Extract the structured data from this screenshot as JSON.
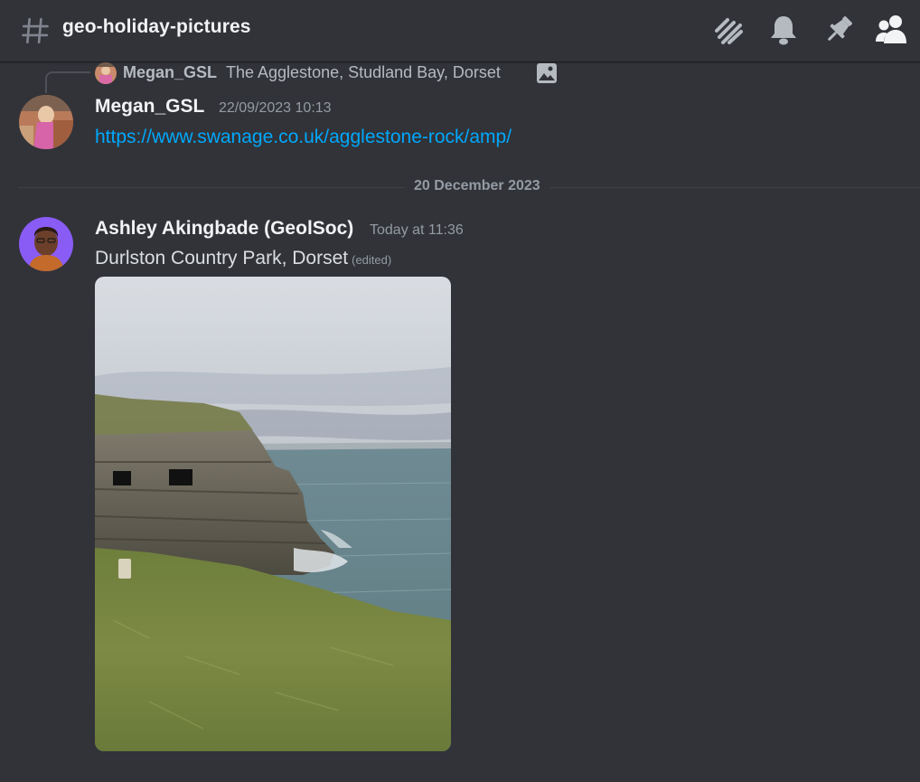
{
  "header": {
    "channel_name": "geo-holiday-pictures",
    "icons": [
      "threads-icon",
      "bell-icon",
      "pin-icon",
      "members-icon"
    ]
  },
  "reply_preview": {
    "author": "Megan_GSL",
    "text": "The Agglestone, Studland Bay, Dorset",
    "icon": "image-icon"
  },
  "messages": [
    {
      "author": "Megan_GSL",
      "timestamp": "22/09/2023 10:13",
      "link": "https://www.swanage.co.uk/agglestone-rock/amp/"
    },
    {
      "author": "Ashley Akingbade (GeolSoc)",
      "timestamp": "Today at 11:36",
      "text": "Durlston Country Park, Dorset",
      "edited": "(edited)"
    }
  ],
  "divider": {
    "date": "20 December 2023"
  },
  "colors": {
    "background": "#313338",
    "link": "#00a8fc",
    "muted": "#949ba4",
    "avatar_ring_purple": "#8a5cf6"
  }
}
